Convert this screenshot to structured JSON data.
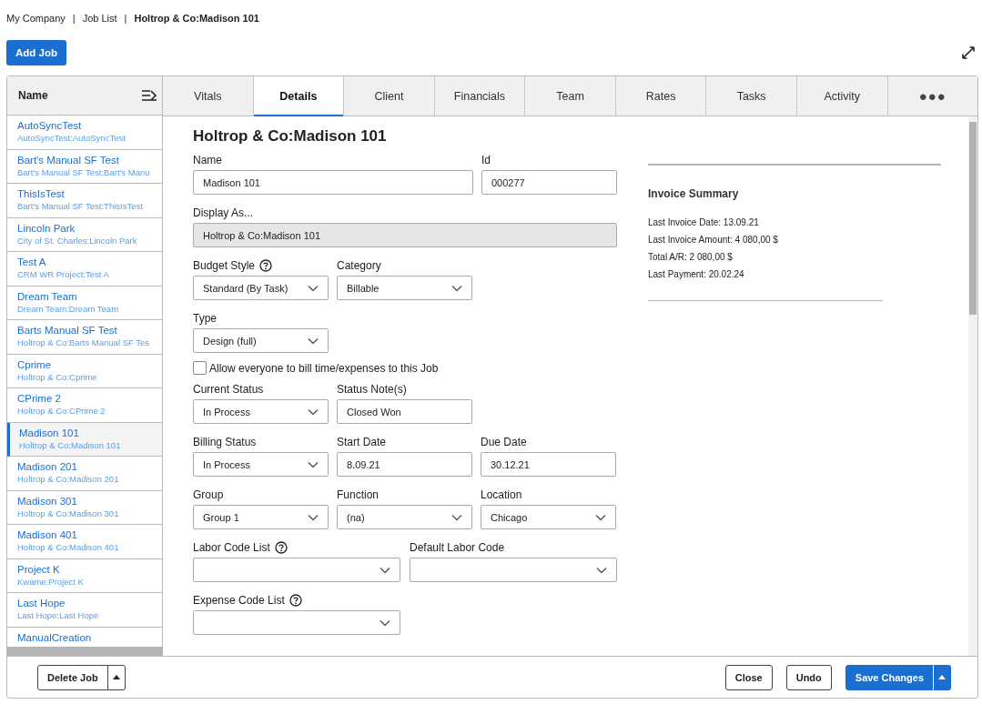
{
  "breadcrumb": [
    {
      "kind": "link",
      "label": "My Company"
    },
    {
      "kind": "separator",
      "label": "|"
    },
    {
      "kind": "link",
      "label": "Job List"
    },
    {
      "kind": "separator",
      "label": "|"
    },
    {
      "kind": "current",
      "label": "Holtrop & Co:Madison 101"
    }
  ],
  "add_button": "Add Job",
  "job_list": {
    "header": "Name",
    "items": [
      {
        "name": "AutoSyncTest",
        "path": "AutoSyncTest:AutoSyncTest",
        "selected": false
      },
      {
        "name": "Bart's Manual SF Test",
        "path": "Bart's Manual SF Test:Bart's Manu",
        "selected": false
      },
      {
        "name": "ThisIsTest",
        "path": "Bart's Manual SF Test:ThisIsTest",
        "selected": false
      },
      {
        "name": "Lincoln Park",
        "path": "City of St. Charles:Lincoln Park",
        "selected": false
      },
      {
        "name": "Test A",
        "path": "CRM WR Project:Test A",
        "selected": false
      },
      {
        "name": "Dream Team",
        "path": "Dream Team:Dream Team",
        "selected": false
      },
      {
        "name": "Barts Manual SF Test",
        "path": "Holtrop & Co:Barts Manual SF Tes",
        "selected": false
      },
      {
        "name": "Cprime",
        "path": "Holtrop & Co:Cprime",
        "selected": false
      },
      {
        "name": "CPrime 2",
        "path": "Holtrop & Co:CPrime 2",
        "selected": false
      },
      {
        "name": "Madison 101",
        "path": "Holtrop & Co:Madison 101",
        "selected": true
      },
      {
        "name": "Madison 201",
        "path": "Holtrop & Co:Madison 201",
        "selected": false
      },
      {
        "name": "Madison 301",
        "path": "Holtrop & Co:Madison 301",
        "selected": false
      },
      {
        "name": "Madison 401",
        "path": "Holtrop & Co:Madison 401",
        "selected": false
      },
      {
        "name": "Project K",
        "path": "Kwame:Project K",
        "selected": false
      },
      {
        "name": "Last Hope",
        "path": "Last Hope:Last Hope",
        "selected": false
      },
      {
        "name": "ManualCreation",
        "selected": false
      }
    ]
  },
  "tabs": [
    {
      "label": "Vitals",
      "selected": false
    },
    {
      "label": "Details",
      "selected": true
    },
    {
      "label": "Client",
      "selected": false
    },
    {
      "label": "Financials",
      "selected": false
    },
    {
      "label": "Team",
      "selected": false
    },
    {
      "label": "Rates",
      "selected": false
    },
    {
      "label": "Tasks",
      "selected": false
    },
    {
      "label": "Activity",
      "selected": false
    },
    {
      "label": "●●●",
      "selected": false
    }
  ],
  "form": {
    "title": "Holtrop & Co:Madison 101",
    "rows": [
      [
        {
          "kind": "text",
          "label": "Name",
          "value": "Madison 101"
        },
        {
          "kind": "text",
          "label": "Id",
          "value": "000277"
        }
      ],
      [
        {
          "kind": "readonly",
          "label": "Display As...",
          "value": "Holtrop & Co:Madison 101"
        }
      ],
      [
        {
          "kind": "select",
          "label": "Budget Style",
          "help": true,
          "value": "Standard (By Task)"
        },
        {
          "kind": "select",
          "label": "Category",
          "value": "Billable"
        }
      ],
      [
        {
          "kind": "select",
          "label": "Type",
          "value": "Design (full)"
        }
      ],
      [
        {
          "kind": "checkbox",
          "label": "Allow everyone to bill time/expenses to this Job",
          "checked": false
        }
      ],
      [
        {
          "kind": "select",
          "label": "Current Status",
          "value": "In Process"
        },
        {
          "kind": "text",
          "label": "Status Note(s)",
          "value": "Closed Won"
        }
      ],
      [
        {
          "kind": "select",
          "label": "Billing Status",
          "value": "In Process"
        },
        {
          "kind": "text",
          "label": "Start Date",
          "value": "8.09.21"
        },
        {
          "kind": "text",
          "label": "Due Date",
          "value": "30.12.21"
        }
      ],
      [
        {
          "kind": "select",
          "label": "Group",
          "value": "Group 1"
        },
        {
          "kind": "select",
          "label": "Function",
          "value": "(na)"
        },
        {
          "kind": "select",
          "label": "Location",
          "value": "Chicago"
        }
      ],
      [
        {
          "kind": "select",
          "label": "Labor Code List",
          "help": true
        },
        {
          "kind": "select",
          "label": "Default Labor Code"
        }
      ],
      [
        {
          "kind": "select",
          "label": "Expense Code List",
          "help": true
        }
      ]
    ]
  },
  "invoice_summary": {
    "title": "Invoice Summary",
    "lines": [
      "Last Invoice Date: 13.09.21",
      "Last Invoice Amount: 4 080,00 $",
      "Total A/R: 2 080,00 $",
      "Last Payment: 20.02.24"
    ]
  },
  "footer": {
    "left": [
      {
        "label": "Delete Job",
        "primary": false,
        "split": true
      }
    ],
    "right": [
      {
        "label": "Close",
        "primary": false,
        "split": false
      },
      {
        "label": "Undo",
        "primary": false,
        "split": false
      },
      {
        "label": "Save Changes",
        "primary": true,
        "split": true
      }
    ]
  }
}
